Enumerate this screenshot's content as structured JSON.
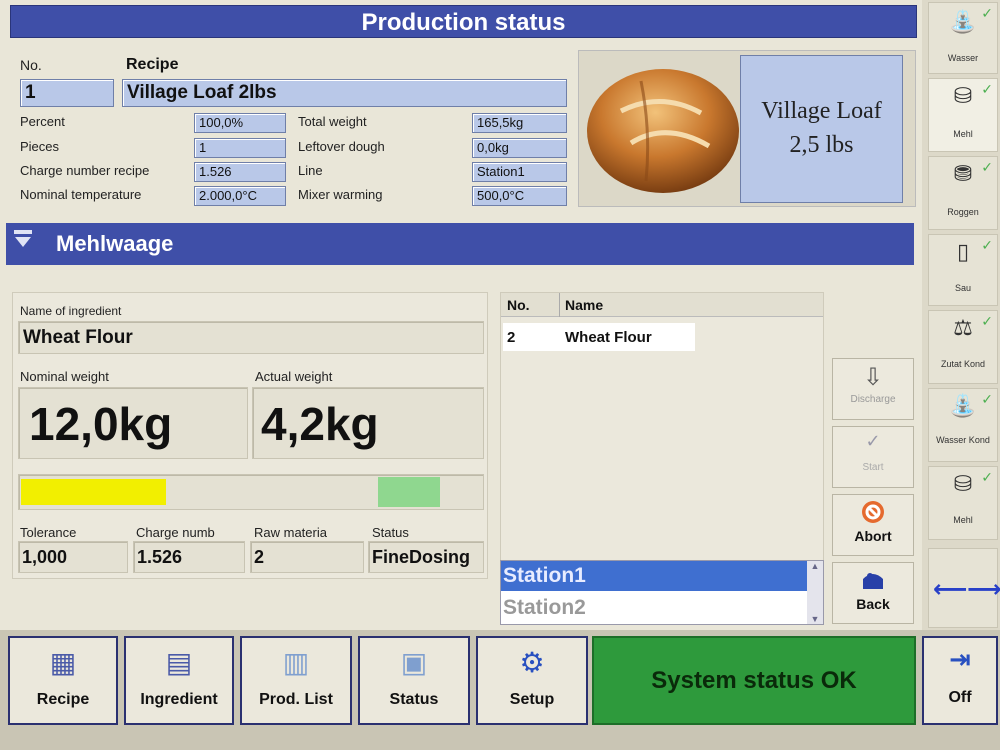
{
  "header": {
    "title": "Production status"
  },
  "recipe": {
    "no_label": "No.",
    "recipe_label": "Recipe",
    "no_value": "1",
    "recipe_value": "Village Loaf 2lbs",
    "fields_left": [
      {
        "label": "Percent",
        "value": "100,0%"
      },
      {
        "label": "Pieces",
        "value": "1"
      },
      {
        "label": "Charge number recipe",
        "value": "1.526"
      },
      {
        "label": "Nominal temperature",
        "value": "2.000,0°C"
      }
    ],
    "fields_right": [
      {
        "label": "Total weight",
        "value": "165,5kg"
      },
      {
        "label": "Leftover dough",
        "value": "0,0kg"
      },
      {
        "label": "Line",
        "value": "Station1"
      },
      {
        "label": "Mixer warming",
        "value": "500,0°C"
      }
    ],
    "image_caption_line1": "Village Loaf",
    "image_caption_line2": "2,5 lbs"
  },
  "section": {
    "title": "Mehlwaage"
  },
  "ingredient": {
    "name_label": "Name of ingredient",
    "name_value": "Wheat Flour",
    "nominal_label": "Nominal weight",
    "nominal_value": "12,0kg",
    "actual_label": "Actual weight",
    "actual_value": "4,2kg",
    "progress_fraction": 0.35,
    "tolerance_label": "Tolerance",
    "tolerance_value": "1,000",
    "charge_label": "Charge numb",
    "charge_value": "1.526",
    "raw_label": "Raw materia",
    "raw_value": "2",
    "status_label": "Status",
    "status_value": "FineDosing"
  },
  "table": {
    "col_no": "No.",
    "col_name": "Name",
    "rows": [
      {
        "no": "2",
        "name": "Wheat Flour"
      }
    ]
  },
  "stations": {
    "items": [
      "Station1",
      "Station2"
    ]
  },
  "right_buttons": {
    "discharge": "Discharge",
    "start": "Start",
    "abort": "Abort",
    "back": "Back"
  },
  "side_nav": {
    "items": [
      "Wasser",
      "Mehl",
      "Roggen",
      "Sau",
      "Zutat Kond",
      "Wasser Kond",
      "Mehl"
    ]
  },
  "bottom": {
    "recipe": "Recipe",
    "ingredient": "Ingredient",
    "prod_list": "Prod. List",
    "status": "Status",
    "setup": "Setup",
    "system_status": "System status OK",
    "off": "Off"
  },
  "colors": {
    "title_bar": "#3f4fa8",
    "field": "#b9c8e8",
    "status_ok": "#2e9a3c",
    "progress_yellow": "#f2ef00",
    "progress_green": "#8fd78f"
  }
}
